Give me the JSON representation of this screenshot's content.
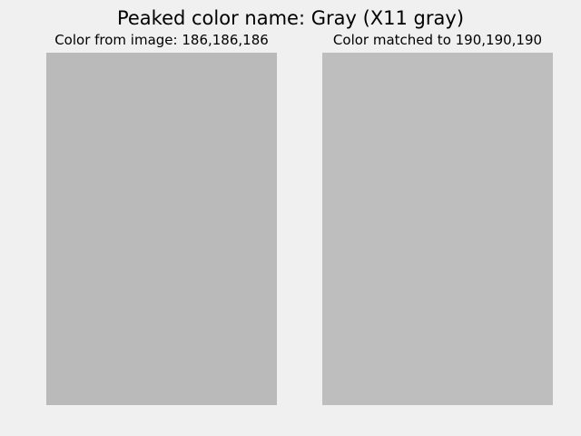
{
  "figure": {
    "title": "Peaked color name: Gray (X11 gray)",
    "background_color": "#f0f0f0"
  },
  "panels": [
    {
      "title": "Color from image: 186,186,186",
      "swatch_color": "#bababa"
    },
    {
      "title": "Color matched to 190,190,190",
      "swatch_color": "#bebebe"
    }
  ]
}
